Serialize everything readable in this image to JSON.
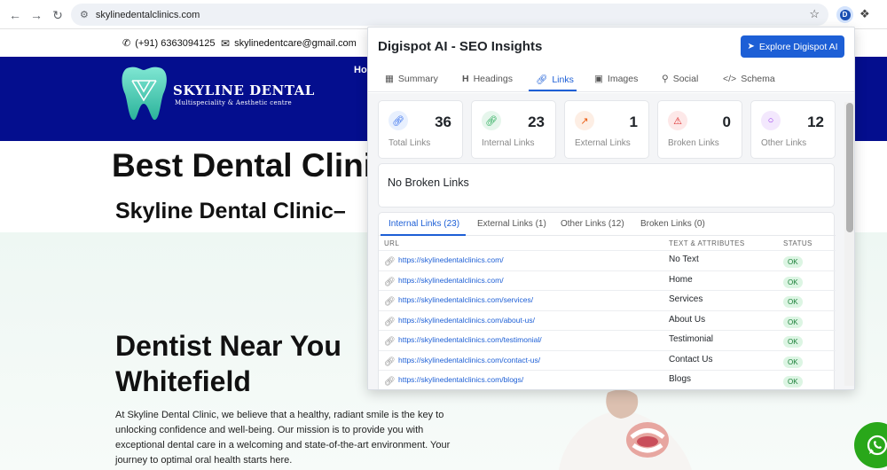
{
  "browser": {
    "url": "skylinedentalclinics.com",
    "extension_letter": "D"
  },
  "site": {
    "phone": "(+91) 6363094125",
    "email": "skylinedentcare@gmail.com",
    "logo_name": "SKYLINE DENTAL",
    "logo_sub": "Multispeciality & Aesthetic centre",
    "nav_partial": "Ho",
    "heading1": "Best Dental Clini",
    "heading2": "Skyline Dental Clinic–",
    "heading3_line1": "Dentist Near You",
    "heading3_line2": "Whitefield",
    "paragraph": "At Skyline Dental Clinic, we believe that a healthy, radiant smile is the key to unlocking confidence and well-being. Our mission is to provide you with exceptional dental care in a welcoming and state-of-the-art environment. Your journey to optimal oral health starts here."
  },
  "popup": {
    "title": "Digispot AI - SEO Insights",
    "explore_label": "Explore Digispot AI",
    "tabs": [
      "Summary",
      "Headings",
      "Links",
      "Images",
      "Social",
      "Schema"
    ],
    "active_tab": "Links",
    "stats": [
      {
        "value": "36",
        "label": "Total Links",
        "icon": "link-icon",
        "color": "#2563eb",
        "bg": "#e8f0fe"
      },
      {
        "value": "23",
        "label": "Internal Links",
        "icon": "link-icon",
        "color": "#16a34a",
        "bg": "#e6f6ec"
      },
      {
        "value": "1",
        "label": "External Links",
        "icon": "external-link-icon",
        "color": "#ea580c",
        "bg": "#fdeee4"
      },
      {
        "value": "0",
        "label": "Broken Links",
        "icon": "warning-icon",
        "color": "#dc2626",
        "bg": "#fde8e8"
      },
      {
        "value": "12",
        "label": "Other Links",
        "icon": "chat-icon",
        "color": "#9333ea",
        "bg": "#f3e8fd"
      }
    ],
    "no_broken_text": "No Broken Links",
    "subtabs": [
      "Internal Links (23)",
      "External Links (1)",
      "Other Links (12)",
      "Broken Links (0)"
    ],
    "columns": {
      "url": "URL",
      "text": "TEXT & ATTRIBUTES",
      "status": "STATUS"
    },
    "rows": [
      {
        "url": "https://skylinedentalclinics.com/",
        "text": "No Text",
        "status": "OK"
      },
      {
        "url": "https://skylinedentalclinics.com/",
        "text": "Home",
        "status": "OK"
      },
      {
        "url": "https://skylinedentalclinics.com/services/",
        "text": "Services",
        "status": "OK"
      },
      {
        "url": "https://skylinedentalclinics.com/about-us/",
        "text": "About Us",
        "status": "OK"
      },
      {
        "url": "https://skylinedentalclinics.com/testimonial/",
        "text": "Testimonial",
        "status": "OK"
      },
      {
        "url": "https://skylinedentalclinics.com/contact-us/",
        "text": "Contact Us",
        "status": "OK"
      },
      {
        "url": "https://skylinedentalclinics.com/blogs/",
        "text": "Blogs",
        "status": "OK"
      }
    ]
  }
}
